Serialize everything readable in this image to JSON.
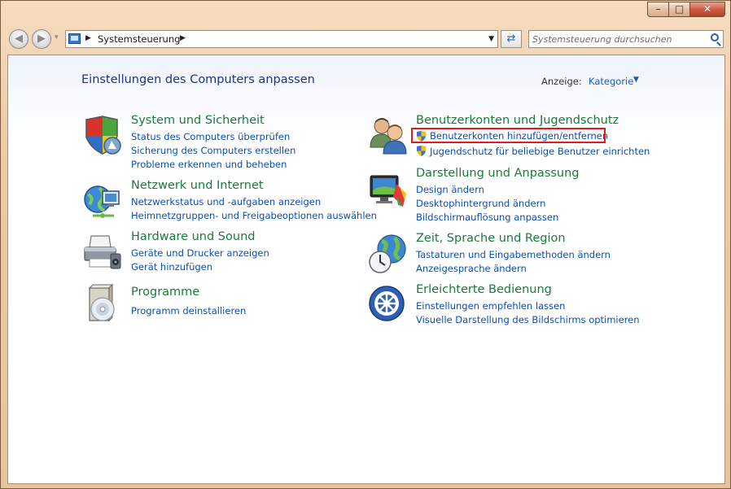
{
  "window": {
    "minimize_glyph": "–",
    "maximize_glyph": "□",
    "close_glyph": "✕"
  },
  "navigation": {
    "back_glyph": "◀",
    "forward_glyph": "▶",
    "history_glyph": "▾",
    "address_path": "Systemsteuerung",
    "separator_glyph": "▶",
    "dropdown_glyph": "▼",
    "refresh_glyph": "⇄",
    "search_placeholder": "Systemsteuerung durchsuchen"
  },
  "header": {
    "title": "Einstellungen des Computers anpassen",
    "view_label": "Anzeige:",
    "view_value": "Kategorie",
    "view_dropdown_glyph": "▼"
  },
  "categories_left": [
    {
      "heading": "System und Sicherheit",
      "icon": "shield-icon",
      "links": [
        "Status des Computers überprüfen",
        "Sicherung des Computers erstellen",
        "Probleme erkennen und beheben"
      ]
    },
    {
      "heading": "Netzwerk und Internet",
      "icon": "network-icon",
      "links": [
        "Netzwerkstatus und -aufgaben anzeigen",
        "Heimnetzgruppen- und Freigabeoptionen auswählen"
      ]
    },
    {
      "heading": "Hardware und Sound",
      "icon": "printer-icon",
      "links": [
        "Geräte und Drucker anzeigen",
        "Gerät hinzufügen"
      ]
    },
    {
      "heading": "Programme",
      "icon": "programs-icon",
      "links": [
        "Programm deinstallieren"
      ]
    }
  ],
  "categories_right": [
    {
      "heading": "Benutzerkonten und Jugendschutz",
      "icon": "users-icon",
      "links": [
        "Benutzerkonten hinzufügen/entfernen",
        "Jugendschutz für beliebige Benutzer einrichten"
      ],
      "highlighted_link": "Benutzerkonten hinzufügen/entfernen"
    },
    {
      "heading": "Darstellung und Anpassung",
      "icon": "display-icon",
      "links": [
        "Design ändern",
        "Desktophintergrund ändern",
        "Bildschirmauflösung anpassen"
      ]
    },
    {
      "heading": "Zeit, Sprache und Region",
      "icon": "globe-clock-icon",
      "links": [
        "Tastaturen und Eingabemethoden ändern",
        "Anzeigesprache ändern"
      ]
    },
    {
      "heading": "Erleichterte Bedienung",
      "icon": "accessibility-icon",
      "links": [
        "Einstellungen empfehlen lassen",
        "Visuelle Darstellung des Bildschirms optimieren"
      ]
    }
  ],
  "colors": {
    "heading_green": "#1b7a3a",
    "link_blue": "#0a4fb4",
    "title_blue": "#1e3287",
    "highlight_red": "#e11c1c"
  }
}
